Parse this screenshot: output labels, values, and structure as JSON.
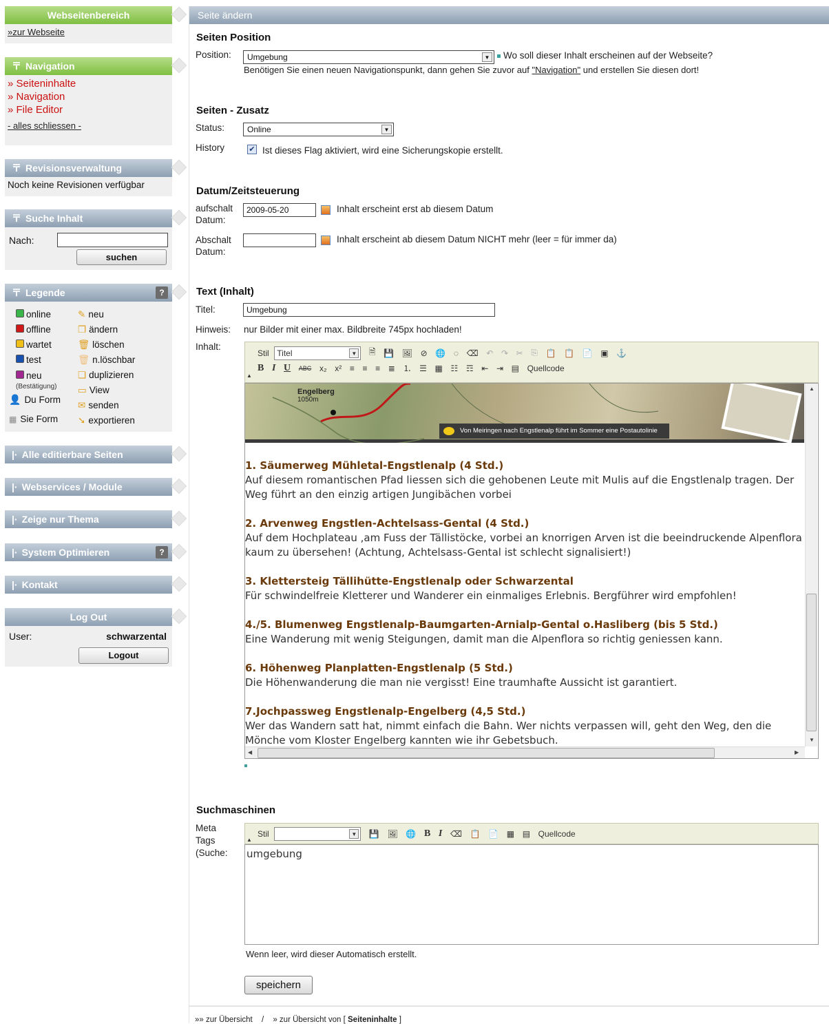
{
  "sidebar": {
    "webseite": {
      "title": "Webseitenbereich",
      "link": "»zur Webseite"
    },
    "navigation": {
      "title": "Navigation",
      "items": [
        "» Seiteninhalte",
        "» Navigation",
        "» File Editor"
      ],
      "close": "- alles schliessen -"
    },
    "revision": {
      "title": "Revisionsverwaltung",
      "text": "Noch keine Revisionen verfügbar"
    },
    "suche": {
      "title": "Suche Inhalt",
      "label": "Nach:",
      "button": "suchen",
      "value": ""
    },
    "legende": {
      "title": "Legende",
      "help": "?",
      "status": [
        "online",
        "offline",
        "wartet",
        "test",
        "neu"
      ],
      "neu_sub": "(Bestätigung)",
      "actions": [
        "neu",
        "ändern",
        "löschen",
        "n.löschbar",
        "duplizieren",
        "View",
        "senden",
        "exportieren"
      ],
      "forms": [
        "Du Form",
        "Sie Form"
      ]
    },
    "alle": "Alle editierbare Seiten",
    "webservices": "Webservices / Module",
    "thema": "Zeige nur Thema",
    "optimieren": "System Optimieren",
    "kontakt": "Kontakt",
    "logout": {
      "title": "Log Out",
      "user_label": "User:",
      "user": "schwarzental",
      "button": "Logout"
    }
  },
  "main": {
    "title": "Seite ändern",
    "position": {
      "heading": "Seiten Position",
      "label": "Position:",
      "value": "Umgebung",
      "hint": "Wo soll dieser Inhalt erscheinen auf der Webseite?",
      "hint2a": "Benötigen Sie einen neuen Navigationspunkt, dann gehen Sie zuvor auf ",
      "hint2link": "\"Navigation\"",
      "hint2b": " und erstellen Sie diesen dort!"
    },
    "zusatz": {
      "heading": "Seiten - Zusatz",
      "status_label": "Status:",
      "status": "Online",
      "history_label": "History",
      "history_text": "Ist dieses Flag aktiviert, wird eine Sicherungskopie erstellt."
    },
    "datum": {
      "heading": "Datum/Zeitsteuerung",
      "auf_l1": "aufschalt",
      "auf_l2": "Datum:",
      "auf_value": "2009-05-20",
      "auf_text": "Inhalt erscheint erst ab diesem Datum",
      "ab_l1": "Abschalt",
      "ab_l2": "Datum:",
      "ab_value": "",
      "ab_text": "Inhalt erscheint ab diesem Datum NICHT mehr (leer = für immer da)"
    },
    "text": {
      "heading": "Text (Inhalt)",
      "titel_label": "Titel:",
      "titel": "Umgebung",
      "hinweis_label": "Hinweis:",
      "hinweis": "nur Bilder mit einer max. Bildbreite 745px hochladen!",
      "inhalt_label": "Inhalt:",
      "stil": "Stil",
      "stil_value": "Titel",
      "quellcode": "Quellcode",
      "map_caption": "Von Meiringen nach Engstlenalp führt im Sommer eine Postautolinie",
      "map_place": "Engelberg",
      "map_alt": "1050m",
      "blocks": [
        {
          "h": "1. Säumerweg Mühletal-Engstlenalp (4 Std.)",
          "p": "Auf diesem romantischen Pfad liessen sich die gehobenen Leute mit Mulis auf die Engstlenalp tragen. Der Weg führt an den einzig artigen Jungibächen vorbei"
        },
        {
          "h": "2. Arvenweg Engstlen-Achtelsass-Gental (4 Std.)",
          "p": "Auf dem Hochplateau ,am  Fuss der Tällistöcke, vorbei an knorrigen Arven ist die beeindruckende Alpenflora kaum zu übersehen! (Achtung, Achtelsass-Gental ist schlecht  signalisiert!)"
        },
        {
          "h": "3. Klettersteig Tällihütte-Engstlenalp oder Schwarzental",
          "p": "Für schwindelfreie Kletterer und Wanderer ein einmaliges Erlebnis. Bergführer wird empfohlen!"
        },
        {
          "h": "4./5. Blumenweg Engstlenalp-Baumgarten-Arnialp-Gental o.Hasliberg (bis 5 Std.)",
          "p": "Eine Wanderung mit wenig Steigungen, damit man die Alpenflora so richtig geniessen kann."
        },
        {
          "h": "6. Höhenweg Planplatten-Engstlenalp (5 Std.)",
          "p": "Die Höhenwanderung die man nie vergisst! Eine traumhafte Aussicht ist garantiert."
        },
        {
          "h": "7.Jochpassweg Engstlenalp-Engelberg (4,5 Std.)",
          "p": "Wer das Wandern satt hat, nimmt einfach die Bahn. Wer nichts verpassen will, geht den Weg, den die Mönche vom Kloster Engelberg kannten wie ihr Gebetsbuch."
        }
      ]
    },
    "such": {
      "heading": "Suchmaschinen",
      "l1": "Meta",
      "l2": "Tags",
      "l3": "(Suche:",
      "stil": "Stil",
      "quellcode": "Quellcode",
      "value": "umgebung",
      "hint": "Wenn leer, wird dieser Automatisch erstellt."
    },
    "save": "speichern",
    "footer": {
      "a": "»» zur Übersicht",
      "sep": "/",
      "b": "» zur Übersicht von [ ",
      "b_bold": "Seiteninhalte",
      "b_end": " ]"
    }
  }
}
